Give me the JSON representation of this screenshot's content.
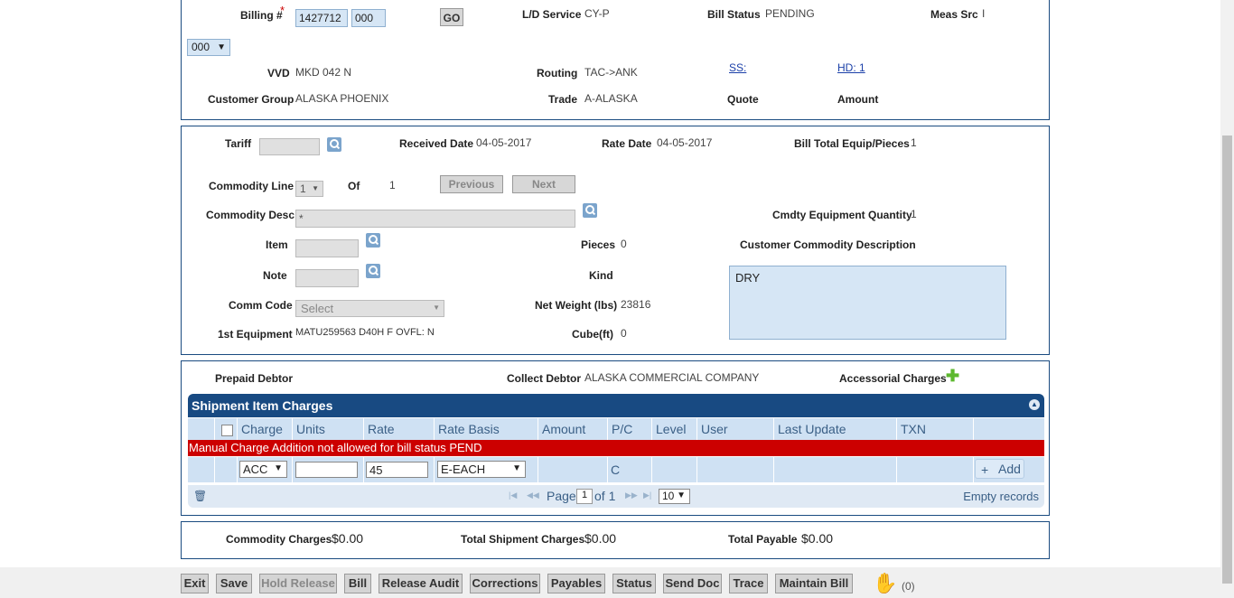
{
  "header": {
    "billing_label": "Billing #",
    "required_mark": "*",
    "billing_number": "1427712",
    "billing_suffix": "000",
    "go_label": "GO",
    "ld_service_label": "L/D Service",
    "ld_service_value": "CY-P",
    "bill_status_label": "Bill Status",
    "bill_status_value": "PENDING",
    "meas_src_label": "Meas Src",
    "meas_src_value": "I",
    "version_select": "000",
    "vvd_label": "VVD",
    "vvd_value": "MKD 042 N",
    "routing_label": "Routing",
    "routing_value": "TAC->ANK",
    "ss_link": "SS:",
    "hd_link": "HD: 1",
    "customer_group_label": "Customer Group",
    "customer_group_value": "ALASKA PHOENIX",
    "trade_label": "Trade",
    "trade_value": "A-ALASKA",
    "quote_label": "Quote",
    "amount_label": "Amount"
  },
  "commodity": {
    "tariff_label": "Tariff",
    "received_date_label": "Received Date",
    "received_date_value": "04-05-2017",
    "rate_date_label": "Rate Date",
    "rate_date_value": "04-05-2017",
    "bill_total_label": "Bill Total Equip/Pieces",
    "bill_total_value": "1",
    "commodity_line_label": "Commodity Line",
    "commodity_line_value": "1",
    "of_label": "Of",
    "of_value": "1",
    "previous_label": "Previous",
    "next_label": "Next",
    "commodity_desc_label": "Commodity Desc",
    "commodity_desc_value": "*",
    "cmdty_equip_qty_label": "Cmdty Equipment Quantity",
    "cmdty_equip_qty_value": "1",
    "item_label": "Item",
    "pieces_label": "Pieces",
    "pieces_value": "0",
    "customer_commodity_desc_label": "Customer Commodity Description",
    "note_label": "Note",
    "kind_label": "Kind",
    "customer_commodity_desc_value": "DRY",
    "comm_code_label": "Comm Code",
    "comm_code_value": "Select",
    "net_weight_label": "Net Weight (lbs)",
    "net_weight_value": "23816",
    "first_equipment_label": "1st Equipment",
    "first_equipment_value": "MATU259563 D40H F OVFL: N",
    "cube_label": "Cube(ft)",
    "cube_value": "0"
  },
  "charges": {
    "prepaid_debtor_label": "Prepaid Debtor",
    "collect_debtor_label": "Collect Debtor",
    "collect_debtor_value": "ALASKA COMMERCIAL COMPANY",
    "accessorial_label": "Accessorial Charges",
    "grid_title": "Shipment Item Charges",
    "columns": [
      "Charge",
      "Units",
      "Rate",
      "Rate Basis",
      "Amount",
      "P/C",
      "Level",
      "User",
      "Last Update",
      "TXN"
    ],
    "error_message": "Manual Charge Addition not allowed for bill status PEND",
    "row": {
      "charge": "ACC",
      "units": "",
      "rate": "45",
      "rate_basis": "E-EACH",
      "pc": "C",
      "add_label": "Add"
    },
    "pager": {
      "page_label": "Page",
      "page_value": "1",
      "of_label": "of 1",
      "page_size": "10",
      "empty_label": "Empty records"
    }
  },
  "totals": {
    "commodity_charges_label": "Commodity Charges",
    "commodity_charges_value": "$0.00",
    "total_shipment_label": "Total Shipment Charges",
    "total_shipment_value": "$0.00",
    "total_payable_label": "Total Payable",
    "total_payable_value": "$0.00"
  },
  "toolbar": {
    "exit": "Exit",
    "save": "Save",
    "hold_release": "Hold Release",
    "bill": "Bill",
    "release_audit": "Release Audit",
    "corrections": "Corrections",
    "payables": "Payables",
    "status": "Status",
    "send_doc": "Send Doc",
    "trace": "Trace",
    "maintain_bill": "Maintain Bill",
    "hold_count": "(0)"
  },
  "colors": {
    "panel_border": "#1a4b80",
    "grid_header": "#184a82",
    "error_bg": "#cc0000",
    "input_bg": "#d6e6f5"
  }
}
